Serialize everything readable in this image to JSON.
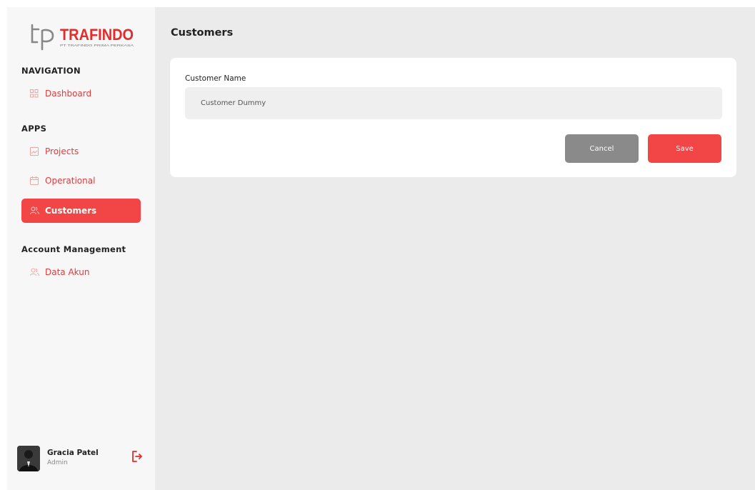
{
  "brand": {
    "name": "TRAFINDO",
    "mark": "tp",
    "tagline": "PT TRAFINDO PRIMA PERKASA",
    "accent_color": "#f24646"
  },
  "sidebar": {
    "sections": [
      {
        "title": "NAVIGATION"
      },
      {
        "title": "APPS"
      },
      {
        "title": "Account Management"
      }
    ],
    "items": [
      {
        "label": "Dashboard",
        "icon": "grid-icon",
        "active": false
      },
      {
        "label": "Projects",
        "icon": "image-icon",
        "active": false
      },
      {
        "label": "Operational",
        "icon": "calendar-icon",
        "active": false
      },
      {
        "label": "Customers",
        "icon": "users-icon",
        "active": true
      },
      {
        "label": "Data Akun",
        "icon": "users-icon",
        "active": false
      }
    ]
  },
  "user": {
    "name": "Gracia Patel",
    "role": "Admin",
    "logout_icon": "logout-icon"
  },
  "main": {
    "title": "Customers",
    "form": {
      "customer_name_label": "Customer Name",
      "customer_name_value": "Customer Dummy",
      "cancel_label": "Cancel",
      "save_label": "Save"
    }
  }
}
